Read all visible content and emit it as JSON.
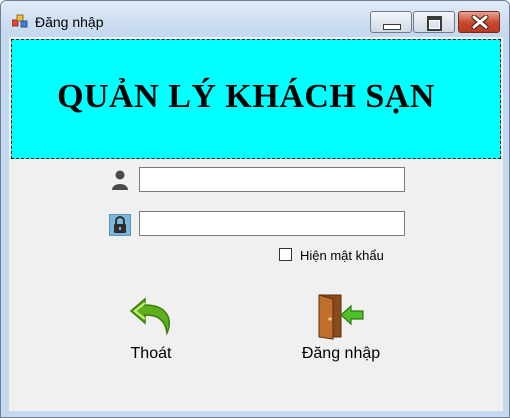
{
  "window": {
    "title": "Đăng nhập",
    "icon": "app-window-icon",
    "controls": [
      "minimize-icon",
      "maximize-icon",
      "close-icon"
    ]
  },
  "banner": {
    "title": "QUẢN LÝ KHÁCH SẠN",
    "background": "#00ffff"
  },
  "form": {
    "username": {
      "icon": "user-icon",
      "value": ""
    },
    "password": {
      "icon": "lock-icon",
      "value": ""
    },
    "show_password": {
      "label": "Hiện mật khẩu",
      "checked": false
    }
  },
  "actions": {
    "exit_label": "Thoát",
    "exit_icon": "back-arrow-icon",
    "login_label": "Đăng nhập",
    "login_icon": "door-enter-icon"
  },
  "colors": {
    "banner": "#00ffff",
    "client": "#f0f0f0",
    "frame": "#c5daf0",
    "close_button": "#c6472c"
  }
}
